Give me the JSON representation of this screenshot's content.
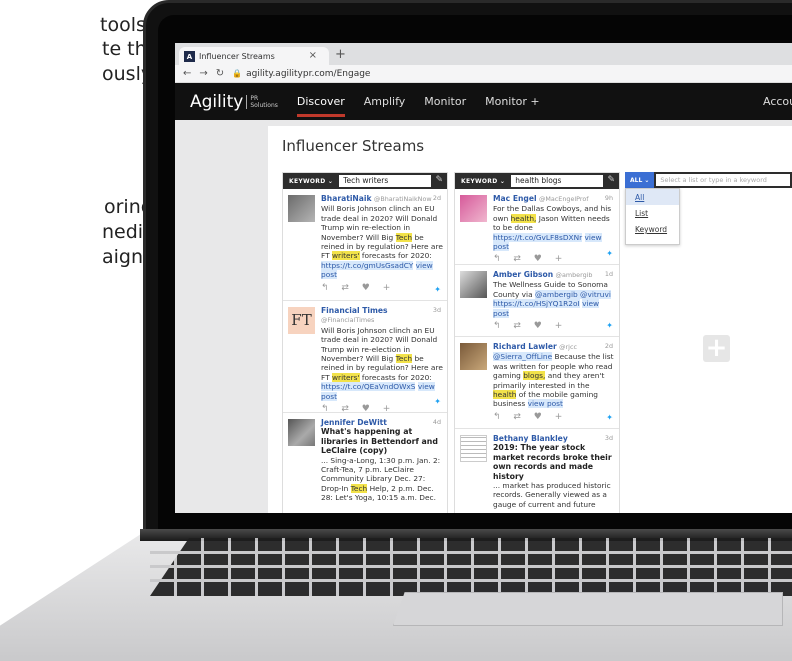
{
  "marketing": {
    "line1": "tools",
    "line2": "te the",
    "line3": "ously",
    "line4": "oring,",
    "line5": "nedia",
    "line6": "aigns,"
  },
  "browser": {
    "tab_title": "Influencer Streams",
    "tab_favicon": "A",
    "tab_close": "×",
    "new_tab": "+",
    "url": "agility.agilitypr.com/Engage"
  },
  "app": {
    "logo": "Agility",
    "logo_sub1": "PR",
    "logo_sub2": "Solutions",
    "nav": [
      "Discover",
      "Amplify",
      "Monitor",
      "Monitor +"
    ],
    "account": "Accoun",
    "page_title": "Influencer Streams"
  },
  "streams": [
    {
      "filter": "KEYWORD ⌄",
      "keyword": "Tech writers",
      "cards": [
        {
          "name": "BharatiNaik",
          "handle": "@BharatiNaikNow",
          "time": "2d",
          "text": "Will Boris Johnson clinch an EU trade deal in 2020? Will Donald Trump win re-election in November? Will Big",
          "hl1": "Tech",
          "text2": "be reined in by regulation? Here are FT",
          "hl2": "writers'",
          "text3": "forecasts for 2020:",
          "link": "https://t.co/gmUsGsadCY",
          "view": "view post"
        },
        {
          "name": "Financial Times",
          "handle": "@FinancialTimes",
          "time": "3d",
          "avatar_text": "FT",
          "text": "Will Boris Johnson clinch an EU trade deal in 2020? Will Donald Trump win re-election in November? Will Big",
          "hl1": "Tech",
          "text2": "be reined in by regulation? Here are FT",
          "hl2": "writers'",
          "text3": "forecasts for 2020:",
          "link": "https://t.co/QEaVndOWxS",
          "view": "view post"
        },
        {
          "name": "Jennifer DeWitt",
          "time": "4d",
          "headline": "What's happening at libraries in Bettendorf and LeClaire (copy)",
          "text": "... Sing-a-Long, 1:30 p.m. Jan. 2: Craft-Tea, 7 p.m. LeClaire Community Library Dec. 27: Drop-In",
          "hl1": "Tech",
          "text2": "Help, 2 p.m. Dec. 28: Let's Yoga, 10:15 a.m. Dec. 31: Pequeños Cuentos: ..."
        }
      ]
    },
    {
      "filter": "KEYWORD ⌄",
      "keyword": "health blogs",
      "cards": [
        {
          "name": "Mac Engel",
          "handle": "@MacEngelProf",
          "time": "9h",
          "text": "For the Dallas Cowboys, and his own",
          "hl1": "health,",
          "text2": "Jason Witten needs to be done",
          "link": "https://t.co/GvLF8sDXNr",
          "view": "view post"
        },
        {
          "name": "Amber Gibson",
          "handle": "@ambergib",
          "time": "1d",
          "text": "The Wellness Guide to Sonoma County via",
          "link1": "@ambergib @vitruvi",
          "link": "https://t.co/HSjYQ1R2oI",
          "view": "view post"
        },
        {
          "name": "Richard Lawler",
          "handle": "@rjcc",
          "time": "2d",
          "link1": "@Sierra_OffLine",
          "text": "Because the list was written for people who read gaming",
          "hl1": "blogs,",
          "text2": "and they aren't primarily interested in the",
          "hl2": "health",
          "text3": "of the mobile gaming business",
          "view": "view post"
        },
        {
          "name": "Bethany Blankley",
          "time": "3d",
          "headline": "2019: The year stock market records broke their own records and made history",
          "text": "... market has produced historic records. Generally viewed as a gauge of current and future"
        }
      ]
    }
  ],
  "list_column": {
    "filter": "ALL ⌄",
    "placeholder": "Select a list or type in a keyword",
    "options": [
      "All",
      "List",
      "Keyword"
    ],
    "selected": "All"
  },
  "icons": {
    "actions": "↰ ⇄ ♥ +",
    "twitter": "✦",
    "wrench": "✎",
    "add": "+"
  }
}
